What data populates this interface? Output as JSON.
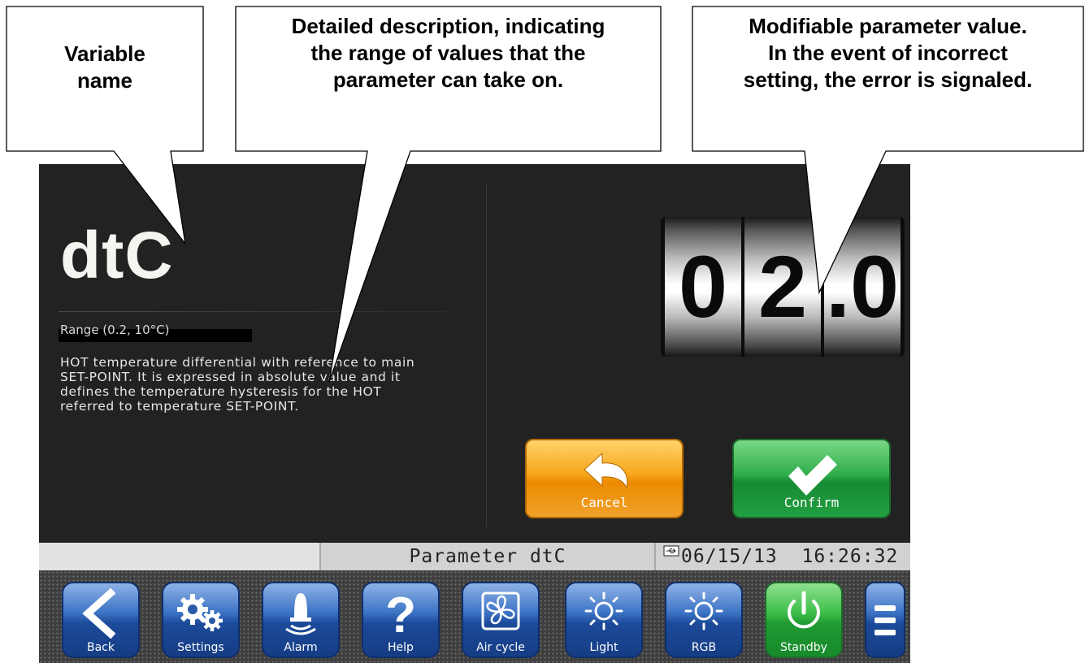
{
  "callouts": {
    "variable_name": "Variable\nname",
    "description": "Detailed description, indicating\nthe range of values that the\nparameter can take on.",
    "modifiable": "Modifiable parameter value.\nIn the event of incorrect\nsetting, the error is signaled."
  },
  "parameter": {
    "name": "dtC",
    "range": "Range (0.2, 10°C)",
    "description": "HOT temperature differential with reference to main\nSET-POINT. It is expressed in absolute value and it\ndefines the temperature hysteresis for the HOT\nreferred to temperature SET-POINT.",
    "digits": [
      "0",
      "2",
      ".0"
    ]
  },
  "actions": {
    "cancel_label": "Cancel",
    "confirm_label": "Confirm"
  },
  "status": {
    "title": "Parameter dtC",
    "date": "06/15/13",
    "time": "16:26:32"
  },
  "toolbar": {
    "back": "Back",
    "settings": "Settings",
    "alarm": "Alarm",
    "help": "Help",
    "air_cycle": "Air cycle",
    "light": "Light",
    "rgb": "RGB",
    "standby": "Standby"
  },
  "icons": {
    "back": "chevron-left-icon",
    "settings": "gears-icon",
    "alarm": "bell-icon",
    "help": "question-mark-icon",
    "air_cycle": "fan-icon",
    "light": "sun-icon",
    "rgb": "sun-icon",
    "standby": "power-icon",
    "menu": "hamburger-menu-icon",
    "cancel": "undo-arrow-icon",
    "confirm": "checkmark-icon",
    "usb": "usb-icon"
  },
  "colors": {
    "screen_bg": "#222222",
    "cancel": "#f29a12",
    "confirm": "#22a042",
    "toolbar_button": "#2c5fb0",
    "standby_button": "#2fae40"
  }
}
